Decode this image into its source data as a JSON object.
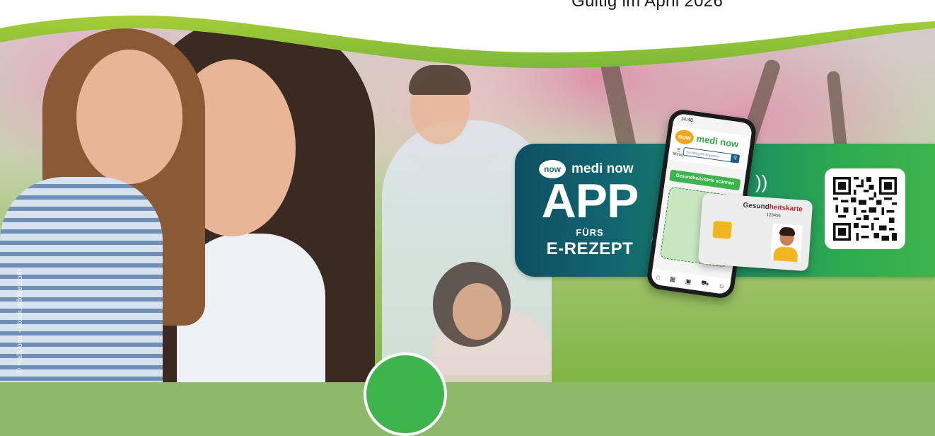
{
  "top_banner": {
    "text": "Gültig im April 2026"
  },
  "photo": {
    "credit": "© Halfpoint - stock.adobe.com"
  },
  "promo": {
    "brand_logo_text": "now",
    "brand_name": "medi now",
    "title": "APP",
    "subtitle": "FÜRS",
    "subtitle2": "E-REZEPT"
  },
  "phone": {
    "time": "14:48",
    "logo_text": "now",
    "brand": "medi now",
    "menu_label": "Menü",
    "search_placeholder": "Suchbegriff eingeben",
    "scan_button": "Gesundheitskarte scannen",
    "tabbar_icons": [
      "home-icon",
      "pharmacy-icon",
      "prescription-icon",
      "cart-icon",
      "profile-icon"
    ]
  },
  "health_card": {
    "title_part1": "Gesund",
    "title_part2": "heitskarte",
    "number": "123456"
  },
  "colors": {
    "brand_green": "#3db44c",
    "brand_teal": "#0e4f62",
    "banner_green": "#8cc63f",
    "chip_yellow": "#f3b422"
  }
}
